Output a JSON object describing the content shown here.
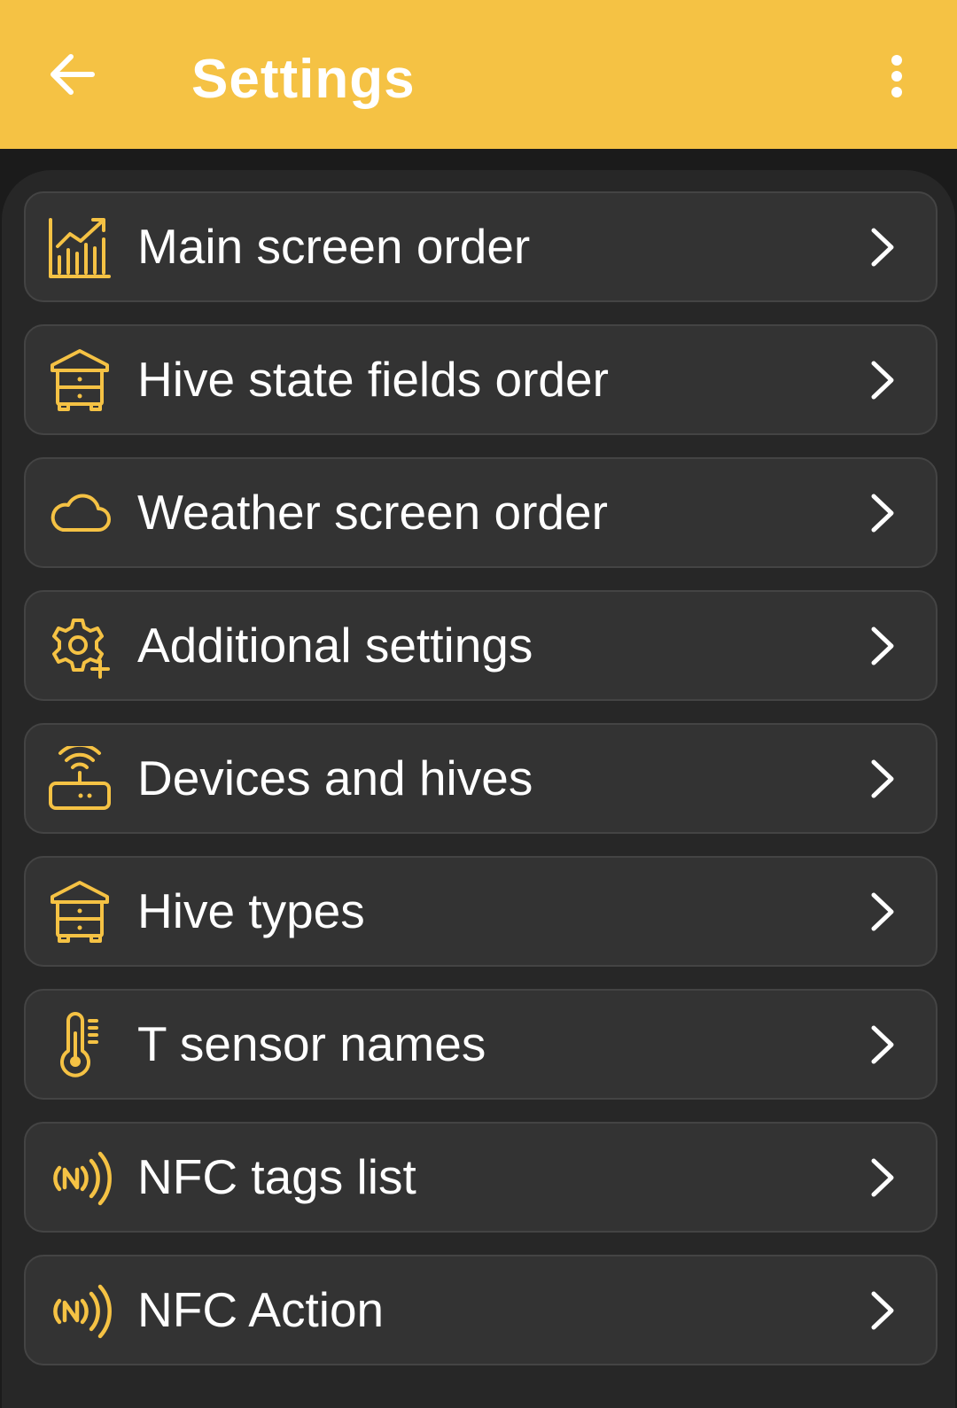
{
  "header": {
    "title": "Settings",
    "back_icon": "arrow-left-icon",
    "menu_icon": "more-vert-icon"
  },
  "colors": {
    "accent": "#f5c244",
    "background": "#1b1b1b",
    "panel": "#272727",
    "item": "#333333",
    "text": "#ffffff"
  },
  "items": [
    {
      "label": "Main screen order",
      "icon": "chart-icon"
    },
    {
      "label": "Hive state fields order",
      "icon": "beehive-icon"
    },
    {
      "label": "Weather screen order",
      "icon": "cloud-icon"
    },
    {
      "label": "Additional settings",
      "icon": "gear-plus-icon"
    },
    {
      "label": "Devices and hives",
      "icon": "router-icon"
    },
    {
      "label": "Hive types",
      "icon": "beehive-icon"
    },
    {
      "label": "T sensor names",
      "icon": "thermometer-icon"
    },
    {
      "label": "NFC tags list",
      "icon": "nfc-icon"
    },
    {
      "label": "NFC Action",
      "icon": "nfc-icon"
    }
  ]
}
